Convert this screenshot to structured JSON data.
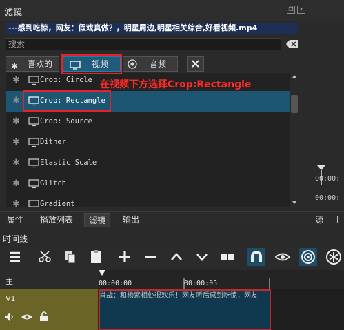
{
  "panel": {
    "title": "滤镜"
  },
  "file_name": "---感到吃惊，网友：假戏真做？，明星周边,明星相关综合,好看视频.mp4",
  "search": {
    "placeholder": "搜索"
  },
  "tabs": {
    "favorites": "喜欢的",
    "video": "视频",
    "audio": "音频"
  },
  "filters": [
    {
      "label": "Crop: Circle",
      "selected": false
    },
    {
      "label": "Crop: Rectangle",
      "selected": true
    },
    {
      "label": "Crop: Source",
      "selected": false
    },
    {
      "label": "Dither",
      "selected": false
    },
    {
      "label": "Elastic Scale",
      "selected": false
    },
    {
      "label": "Glitch",
      "selected": false
    },
    {
      "label": "Gradient",
      "selected": false
    }
  ],
  "annotation": "在视频下方选择Crop:Rectangle",
  "preview": {
    "tc1": "00:00:",
    "tc2": "00:00:"
  },
  "panel_tabs": [
    "属性",
    "播放列表",
    "滤镜",
    "输出",
    "源",
    "I"
  ],
  "timeline": {
    "title": "时间线",
    "master_track": "主",
    "v1_track": "V1",
    "ruler": [
      "00:00:00",
      "00:00:05"
    ],
    "clip_title": "肖战：和杨紫相处很欢乐！网友听后感到吃惊，网友"
  },
  "colors": {
    "accent": "#1f5b7a",
    "annotation": "#e8202a",
    "selection": "#1c5673"
  }
}
